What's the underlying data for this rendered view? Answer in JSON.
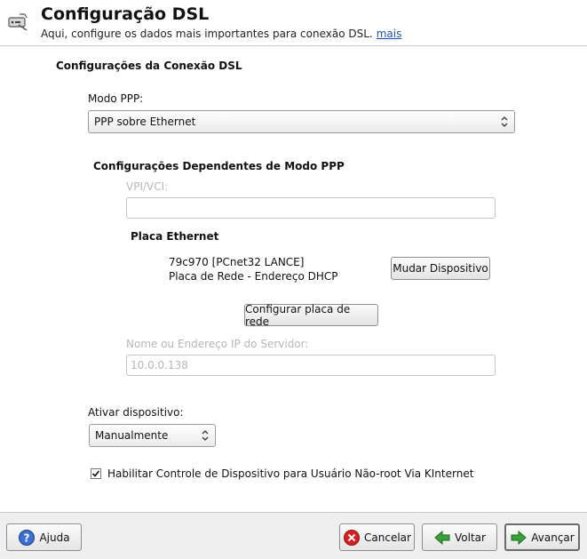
{
  "header": {
    "title": "Configuração DSL",
    "subtitle": "Aqui, configure os dados mais importantes para conexão DSL.",
    "more_link": "mais"
  },
  "connection": {
    "section_title": "Configurações da Conexão DSL",
    "ppp_mode_label": "Modo PPP:",
    "ppp_mode_value": "PPP sobre Ethernet"
  },
  "ppp_dependent": {
    "section_title": "Configurações Dependentes de Modo PPP",
    "vpi_label": "VPI/VCI:",
    "vpi_value": "",
    "ethernet_card_title": "Placa Ethernet",
    "device_name": "79c970 [PCnet32 LANCE]",
    "device_desc": "Placa de Rede - Endereço DHCP",
    "change_device_button": "Mudar Dispositivo",
    "configure_card_button": "Configurar placa de rede",
    "server_label": "Nome ou Endereço IP do Servidor:",
    "server_value": "10.0.0.138"
  },
  "activation": {
    "label": "Ativar dispositivo:",
    "value": "Manualmente",
    "checkbox_label": "Habilitar Controle de Dispositivo para Usuário Não-root Via KInternet",
    "checkbox_checked": true
  },
  "footer": {
    "help_button": "Ajuda",
    "cancel_button": "Cancelar",
    "back_button": "Voltar",
    "next_button": "Avançar"
  },
  "colors": {
    "link": "#1d4fb8",
    "cancel_icon": "#d42020",
    "nav_arrow": "#3aa23a"
  }
}
